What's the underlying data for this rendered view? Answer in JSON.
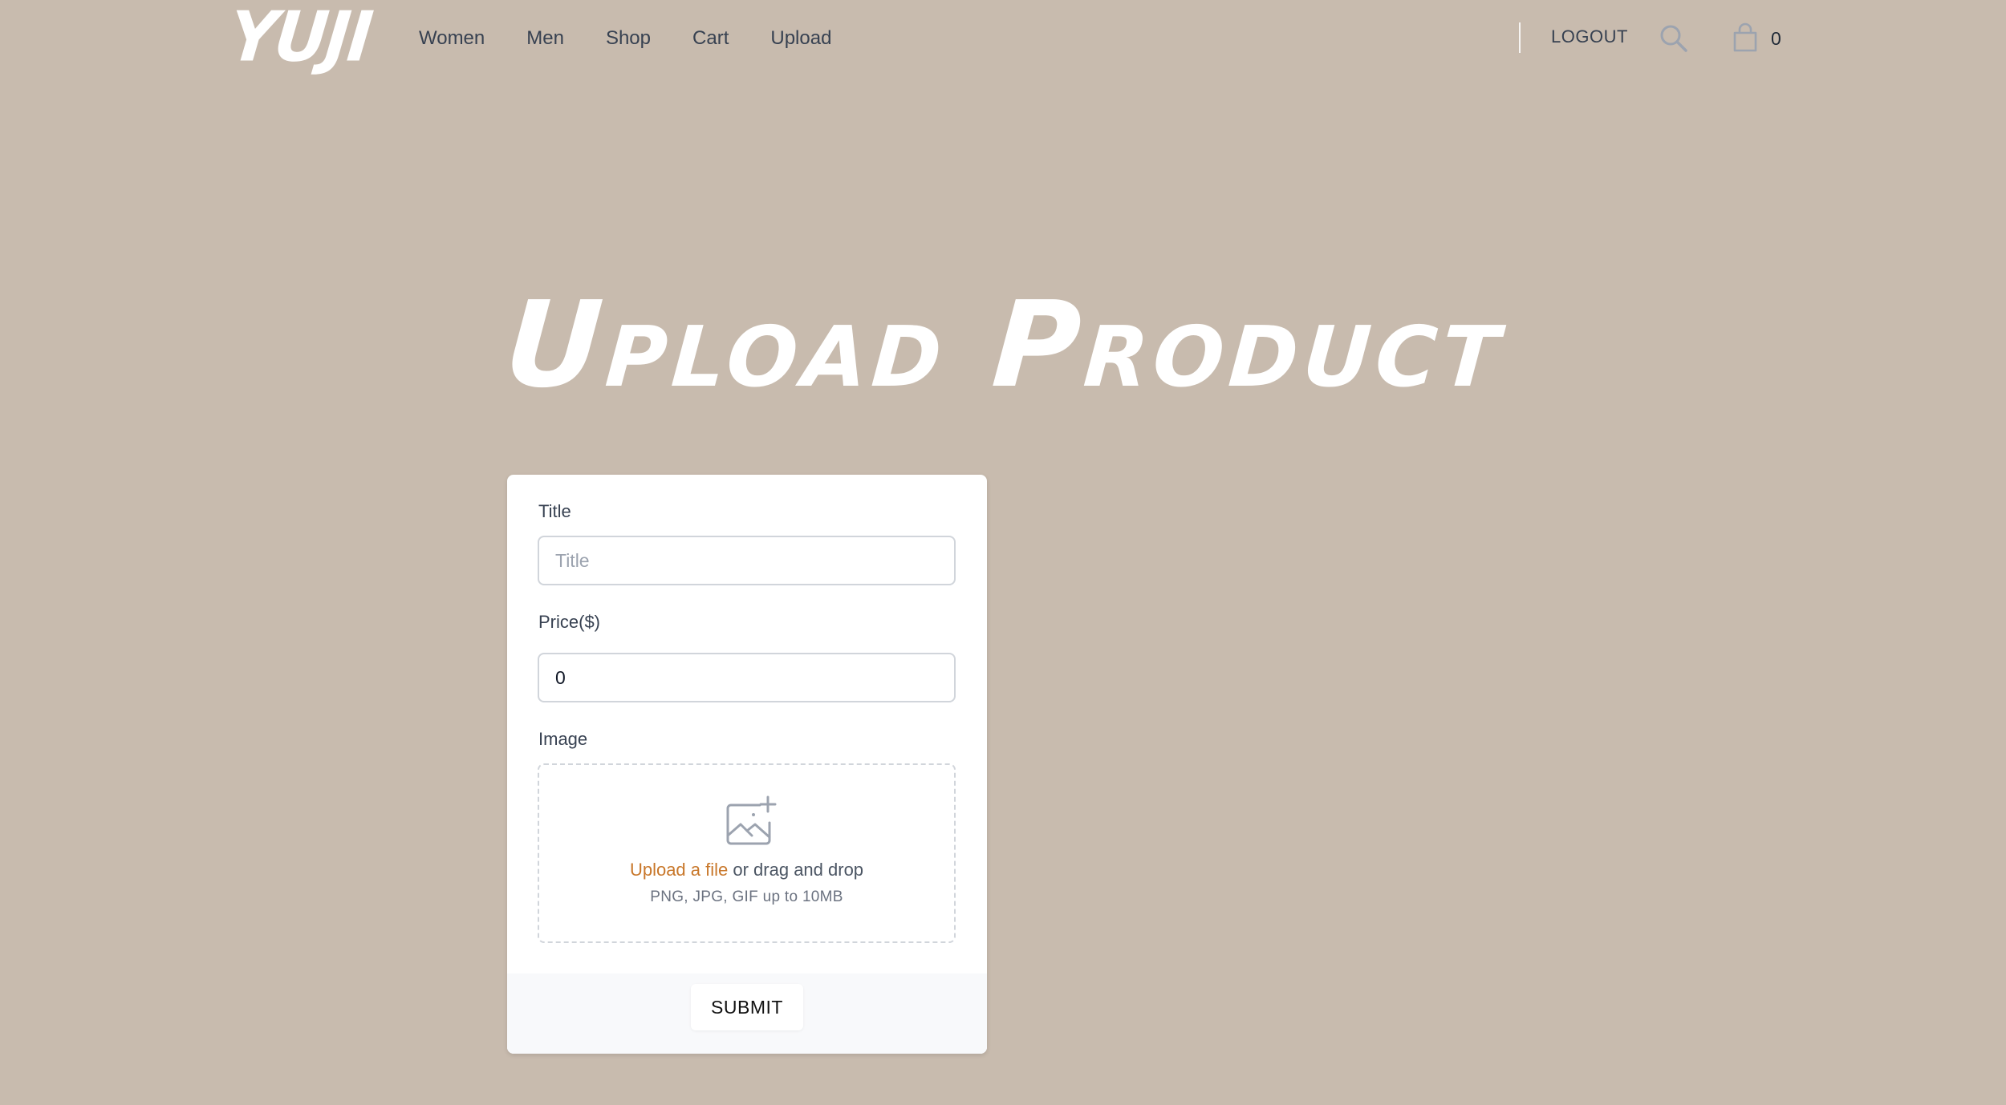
{
  "header": {
    "logo": "YUJI",
    "nav": [
      {
        "label": "Women"
      },
      {
        "label": "Men"
      },
      {
        "label": "Shop"
      },
      {
        "label": "Cart"
      },
      {
        "label": "Upload"
      }
    ],
    "logout_label": "LOGOUT",
    "search_icon": "search-icon",
    "cart_icon": "shopping-bag-icon",
    "cart_count": "0"
  },
  "page": {
    "title": "Upload Product"
  },
  "form": {
    "title_label": "Title",
    "title_placeholder": "Title",
    "title_value": "",
    "price_label": "Price($)",
    "price_value": "0",
    "image_label": "Image",
    "image_icon": "image-add-icon",
    "upload_link": "Upload a file",
    "upload_suffix": " or drag and drop",
    "upload_hint": "PNG, JPG, GIF up to 10MB",
    "submit_label": "SUBMIT"
  },
  "colors": {
    "background": "#c8bbae",
    "accent": "#c8772a",
    "card": "#ffffff",
    "footer": "#f8f9fb",
    "text": "#374151"
  }
}
